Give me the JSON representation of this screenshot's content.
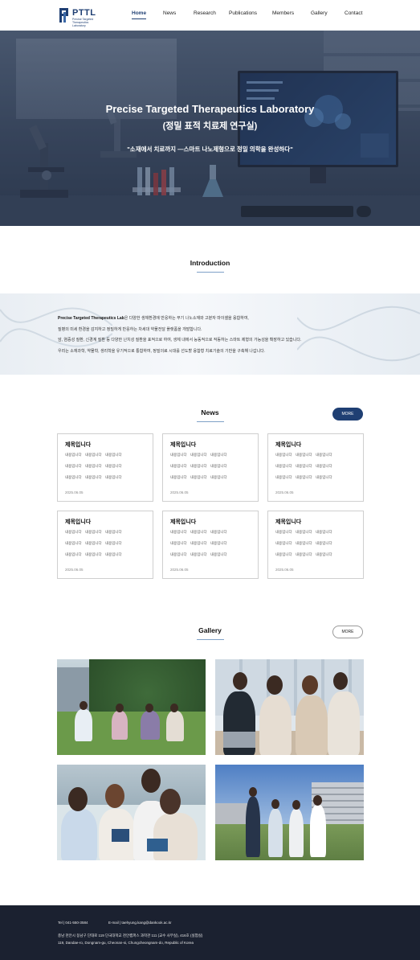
{
  "header": {
    "logo_title": "PTTL",
    "logo_subtitle": "Precise Targeted Therapeutics Laboratory",
    "nav": [
      {
        "label": "Home",
        "active": true
      },
      {
        "label": "News",
        "active": false
      },
      {
        "label": "Research",
        "active": false
      },
      {
        "label": "Publications",
        "active": false
      },
      {
        "label": "Members",
        "active": false
      },
      {
        "label": "Gallery",
        "active": false
      },
      {
        "label": "Contact",
        "active": false
      }
    ]
  },
  "hero": {
    "title": "Precise Targeted Therapeutics Laboratory",
    "subtitle": "(정밀 표적 치료제 연구실)",
    "quote": "\"소재에서 치료까지 —스마트 나노제형으로 정밀 의학을 완성하다\""
  },
  "intro": {
    "title": "Introduction",
    "lab_name": "Precise Targeted Therapeutics Lab",
    "line1_rest": "은 다양한 생체환경에 반응하는 무기 나노소재와 고분자 마이셀을 융합하여,",
    "line2": "질병의 미세 환경을 감지하고 정밀하게 반응하는 차세대 약물전달 플랫폼을 개발합니다.",
    "line3": "암, 염증성 질환, 신경계 질환 등 다양한 난치성 질환을 표적으로 하여, 생체 내에서 능동적으로 작동하는 스마트 제형의 가능성을 확장하고 있습니다.",
    "line4": "우리는 소재과학, 약물학, 생리학을 유기적으로 통합하여, 정밀의료 시대를 선도할 융합형 치료기술의 기반을 구축해 나갑니다."
  },
  "news": {
    "title": "News",
    "more_label": "MORE",
    "cards": [
      {
        "title": "제목입니다",
        "rows": [
          [
            "내용입니다",
            "내용입니다",
            "내용입니다"
          ],
          [
            "내용입니다",
            "내용입니다",
            "내용입니다"
          ],
          [
            "내용입니다",
            "내용입니다",
            "내용입니다"
          ]
        ],
        "date": "2025.06.05"
      },
      {
        "title": "제목입니다",
        "rows": [
          [
            "내용입니다",
            "내용입니다",
            "내용입니다"
          ],
          [
            "내용입니다",
            "내용입니다",
            "내용입니다"
          ],
          [
            "내용입니다",
            "내용입니다",
            "내용입니다"
          ]
        ],
        "date": "2025.06.05"
      },
      {
        "title": "제목입니다",
        "rows": [
          [
            "내용입니다",
            "내용입니다",
            "내용입니다"
          ],
          [
            "내용입니다",
            "내용입니다",
            "내용입니다"
          ],
          [
            "내용입니다",
            "내용입니다",
            "내용입니다"
          ]
        ],
        "date": "2025.06.05"
      },
      {
        "title": "제목입니다",
        "rows": [
          [
            "내용입니다",
            "내용입니다",
            "내용입니다"
          ],
          [
            "내용입니다",
            "내용입니다",
            "내용입니다"
          ],
          [
            "내용입니다",
            "내용입니다",
            "내용입니다"
          ]
        ],
        "date": "2025.06.05"
      },
      {
        "title": "제목입니다",
        "rows": [
          [
            "내용입니다",
            "내용입니다",
            "내용입니다"
          ],
          [
            "내용입니다",
            "내용입니다",
            "내용입니다"
          ],
          [
            "내용입니다",
            "내용입니다",
            "내용입니다"
          ]
        ],
        "date": "2025.06.05"
      },
      {
        "title": "제목입니다",
        "rows": [
          [
            "내용입니다",
            "내용입니다",
            "내용입니다"
          ],
          [
            "내용입니다",
            "내용입니다",
            "내용입니다"
          ],
          [
            "내용입니다",
            "내용입니다",
            "내용입니다"
          ]
        ],
        "date": "2025.06.05"
      }
    ]
  },
  "gallery": {
    "title": "Gallery",
    "more_label": "MORE",
    "photos": [
      "students-on-lawn",
      "students-laughing-laptops",
      "students-with-books",
      "students-walking-campus"
    ]
  },
  "footer": {
    "tel": "Tel | 041-550-3584",
    "email": "E-mail | taehyung.kang@dankook.ac.kr",
    "address_ko": "충남 천안시 동남구 단대로 119 단국대학교 천안캠퍼스 과학관 111 (교수 사무실), 416호 (실험실)",
    "address_en": "119, Dandae-ro, Dongnam-gu, Cheonan-si, Chungcheongnam-do, Republic of Korea"
  },
  "colors": {
    "brand": "#1f3f73",
    "footer_bg": "#1b2130",
    "accent_line": "#7fa1c7"
  }
}
